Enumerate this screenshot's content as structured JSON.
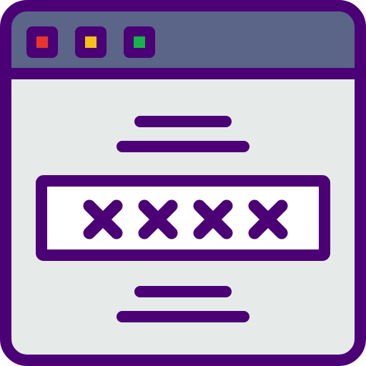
{
  "icon": {
    "name": "password-window-icon",
    "masked_character_count": 4
  },
  "colors": {
    "outline": "#4b0076",
    "titlebar": "#5a6587",
    "window_body": "#e6ebea",
    "password_field": "#ffffff",
    "button_red": "#e8352b",
    "button_yellow": "#f5c019",
    "button_green": "#17b34a",
    "page_background": "#ffffff"
  }
}
